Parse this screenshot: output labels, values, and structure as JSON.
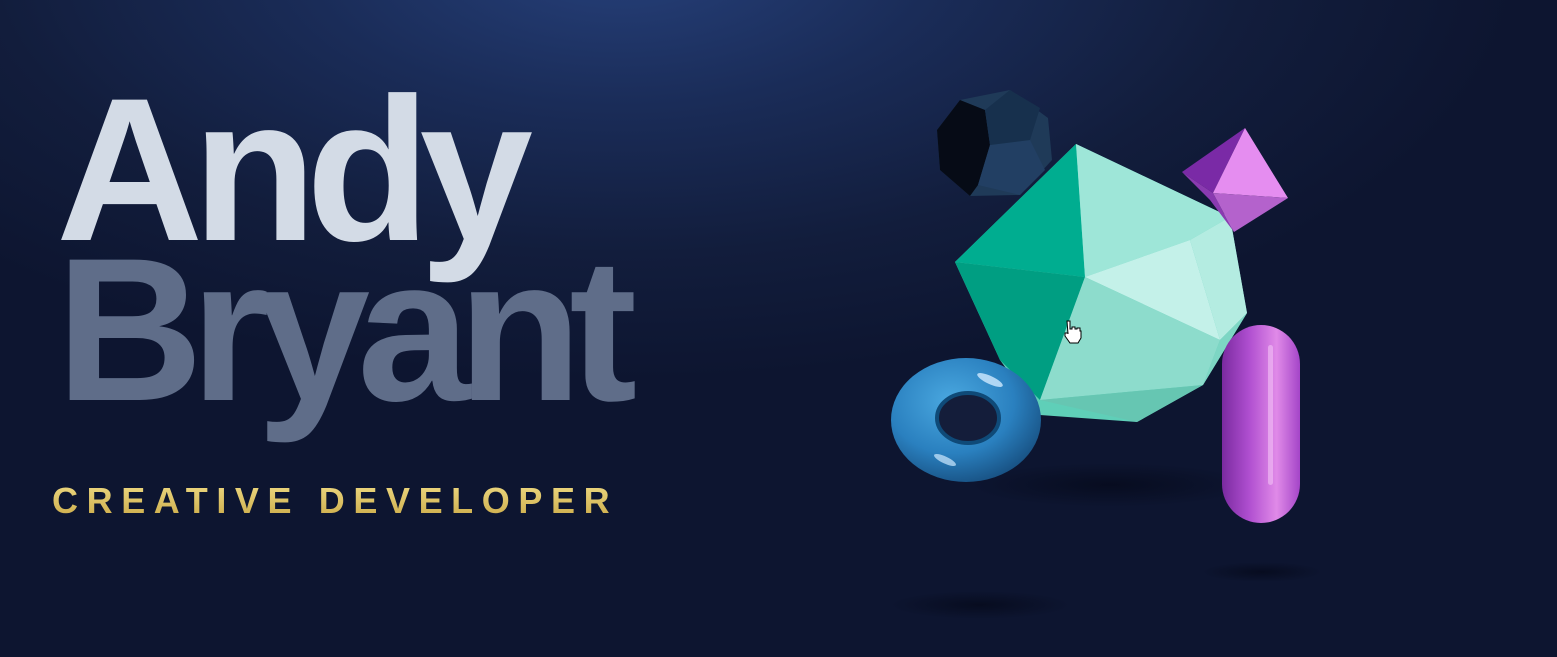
{
  "hero": {
    "first_name": "Andy",
    "last_name": "Bryant",
    "role": "CREATIVE DEVELOPER"
  },
  "colors": {
    "background": "#121d3c",
    "first_name": "#d3dbe6",
    "last_name": "#5f6d89",
    "role": "#d9c062",
    "icosahedron": "#00a88a",
    "torus": "#2a86c2",
    "capsule": "#b04fd0",
    "octahedron": "#e28ae8",
    "dodecahedron": "#1c3350"
  },
  "scene": {
    "objects": [
      "dodecahedron",
      "icosahedron",
      "octahedron",
      "torus",
      "capsule"
    ],
    "cursor": "hand-pointer"
  }
}
